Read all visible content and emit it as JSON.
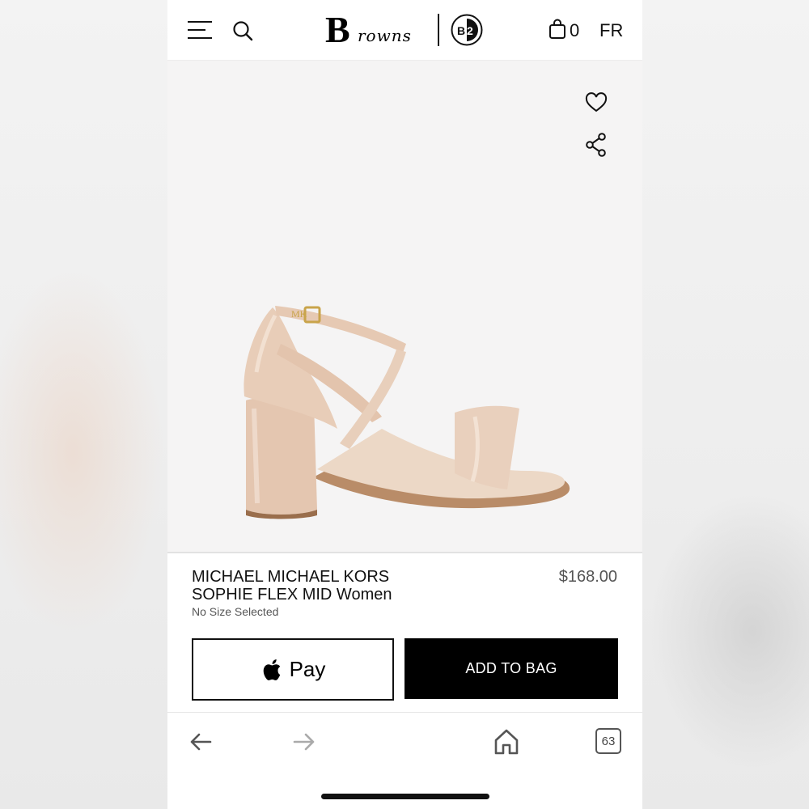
{
  "header": {
    "logo_text": "Browns",
    "logo_badge_text": "B2",
    "bag_count": "0",
    "language": "FR"
  },
  "product": {
    "name": "MICHAEL MICHAEL KORS\nSOPHIE FLEX MID Women",
    "price": "$168.00",
    "size_status": "No Size Selected"
  },
  "actions": {
    "apple_pay_label": "Pay",
    "add_to_bag_label": "ADD TO BAG"
  },
  "browser_toolbar": {
    "tabs_count": "63"
  },
  "icons": {
    "menu": "menu-icon",
    "search": "search-icon",
    "bag": "shopping-bag-icon",
    "wishlist": "heart-icon",
    "share": "share-icon",
    "apple": "apple-logo-icon",
    "back": "back-arrow-icon",
    "forward": "forward-arrow-icon",
    "home": "home-icon",
    "tabs": "tabs-icon"
  },
  "colors": {
    "primary_button": "#000000",
    "image_background": "#f5f4f4",
    "sandal": "#e6cbb6"
  }
}
